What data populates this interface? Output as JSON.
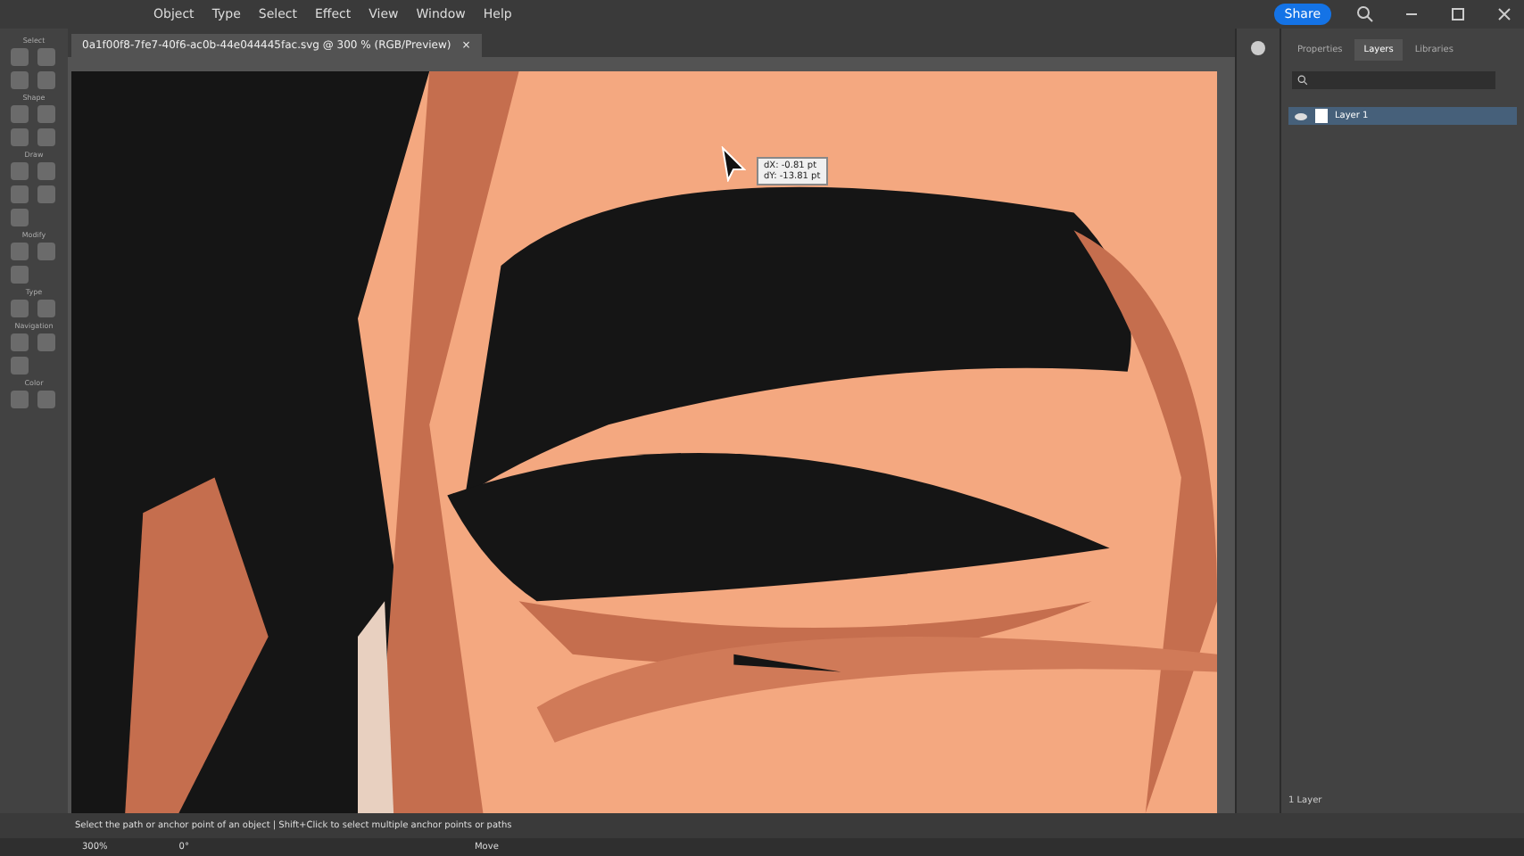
{
  "menu": [
    "Object",
    "Type",
    "Select",
    "Effect",
    "View",
    "Window",
    "Help"
  ],
  "share": "Share",
  "document_tab": {
    "title": "0a1f00f8-7fe7-40f6-ac0b-44e044445fac.svg @ 300 % (RGB/Preview)",
    "close": "×"
  },
  "toolbar_sections": [
    {
      "label": "Select"
    },
    {
      "label": "Shape"
    },
    {
      "label": "Draw"
    },
    {
      "label": "Modify"
    },
    {
      "label": "Type"
    },
    {
      "label": "Navigation"
    },
    {
      "label": "Color"
    }
  ],
  "canvas": {
    "kind": "picture",
    "readout": [
      "dX: -0.81 pt",
      "dY: -13.81 pt"
    ]
  },
  "panel": {
    "tabs": [
      {
        "label": "Properties",
        "selected": false
      },
      {
        "label": "Layers",
        "selected": true
      },
      {
        "label": "Libraries",
        "selected": false
      }
    ],
    "layers": [
      {
        "name": "Layer 1",
        "visible": true,
        "selected": true
      }
    ],
    "footer": "1 Layer"
  },
  "status_bar": {
    "hint": "Select the path or anchor point of an object | Shift+Click to select multiple anchor points or paths",
    "zoom": "300%",
    "angle": "0°",
    "tool": "Move"
  }
}
